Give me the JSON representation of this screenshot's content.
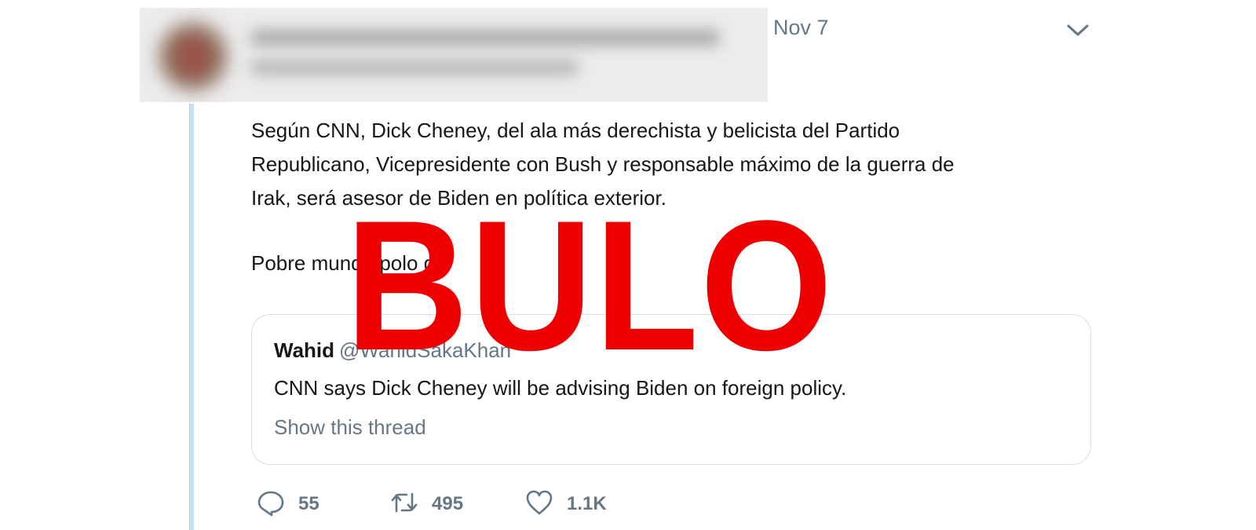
{
  "tweet": {
    "date": "Nov 7",
    "text_lines": [
      "Según CNN, Dick Cheney, del ala más derechista y belicista del Partido",
      "Republicano, Vicepresidente con Bush y responsable máximo de la guerra de",
      "Irak, será asesor de Biden en política exterior."
    ],
    "second_paragraph": "Pobre mundo polo ge",
    "quoted": {
      "name": "Wahid",
      "handle": "@WahidSakaKhan",
      "text": "CNN says Dick Cheney will be advising Biden on foreign policy.",
      "show_thread": "Show this thread"
    },
    "actions": {
      "replies": "55",
      "retweets": "495",
      "likes": "1.1K"
    }
  },
  "overlay": {
    "stamp": "BULO",
    "color": "#ef0000"
  },
  "icons": [
    "chevron-down-icon",
    "reply-icon",
    "retweet-icon",
    "like-icon"
  ],
  "colors": {
    "text": "#14171a",
    "secondary": "#657786",
    "thread_line": "#c6e1f4",
    "border": "#d6dfe6"
  }
}
